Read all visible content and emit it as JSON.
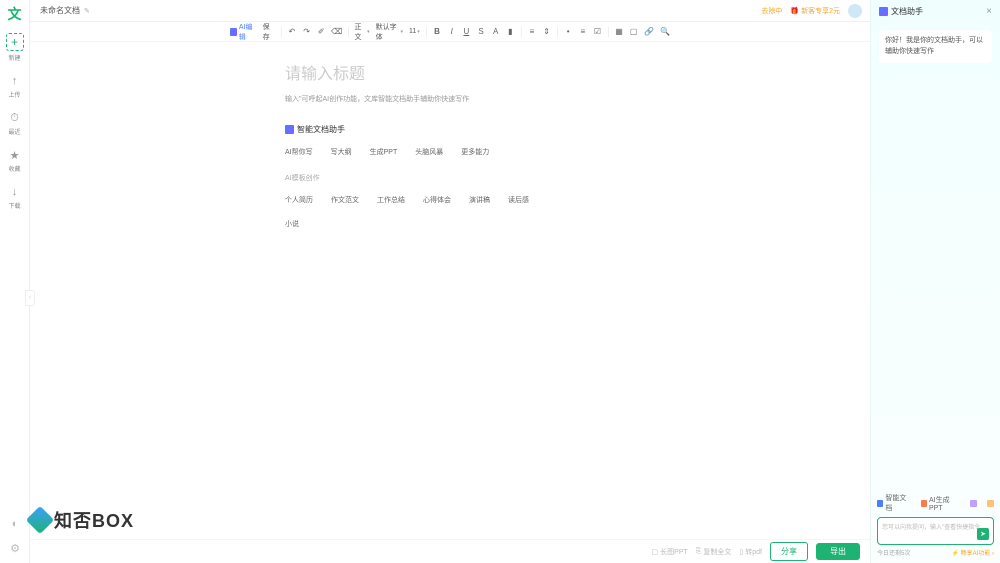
{
  "app": {
    "logo": "文",
    "doc_title": "未命名文档"
  },
  "sidebar": {
    "items": [
      {
        "icon": "+",
        "label": "新建"
      },
      {
        "icon": "↑",
        "label": "上传"
      },
      {
        "icon": "⏱",
        "label": "最近"
      },
      {
        "icon": "★",
        "label": "收藏"
      },
      {
        "icon": "↓",
        "label": "下载"
      }
    ]
  },
  "top_right": {
    "vip": "去除中",
    "gift": "新客专享2元"
  },
  "toolbar": {
    "ai_edit": "AI编辑",
    "save": "保存",
    "style": "正文",
    "font": "默认字体",
    "size": "11"
  },
  "editor": {
    "title_placeholder": "请输入标题",
    "sub_placeholder": "输入\"可呼起AI创作功能，文库智能文档助手辅助你快速写作",
    "helper_title": "智能文档助手",
    "row1": [
      "AI帮你写",
      "写大纲",
      "生成PPT",
      "头脑风暴",
      "更多能力"
    ],
    "template_label": "AI模板创作",
    "row2": [
      "个人简历",
      "作文范文",
      "工作总结",
      "心得体会",
      "演讲稿",
      "读后感"
    ],
    "row3": [
      "小说"
    ]
  },
  "bottom": {
    "items": [
      "长图PPT",
      "复制全文",
      "转pdf"
    ],
    "share": "分享",
    "export": "导出"
  },
  "right_panel": {
    "title": "文档助手",
    "greeting": "你好！我是你的文档助手，可以辅助你快速写作",
    "tabs": [
      "智能文档",
      "AI生成PPT"
    ],
    "input_placeholder": "您可以向我提问，输入\"查看快捷指令",
    "footer_left": "今日还剩5次",
    "footer_right": "畅享AI功能"
  },
  "watermark": "知否BOX"
}
